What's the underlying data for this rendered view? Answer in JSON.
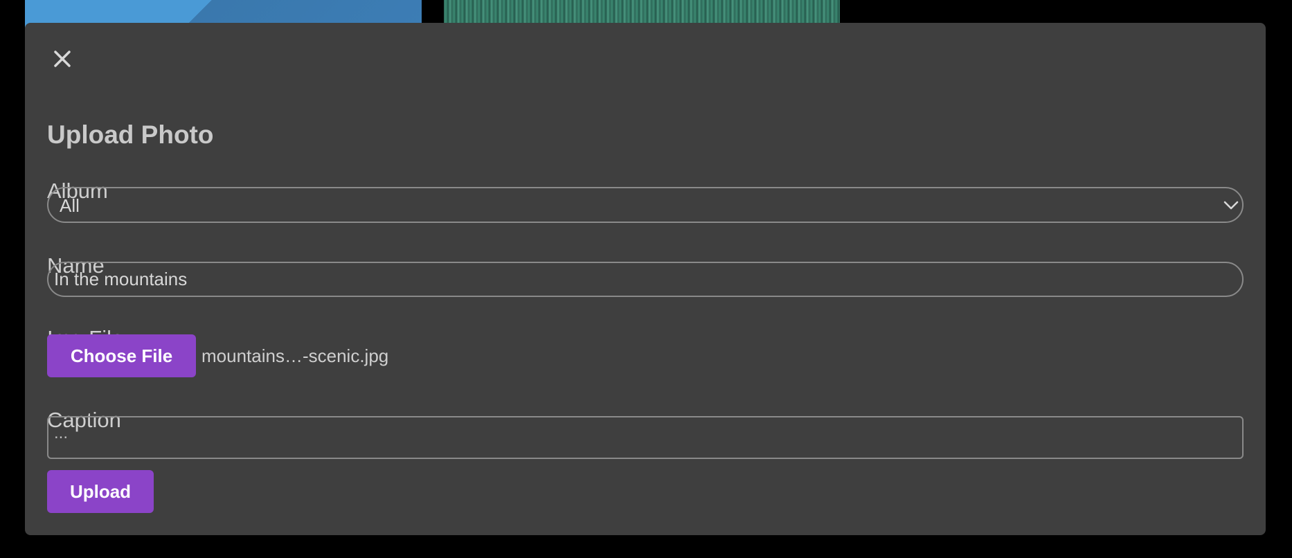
{
  "modal": {
    "title": "Upload Photo",
    "close_icon": "close-icon"
  },
  "form": {
    "album": {
      "label": "Album",
      "selected": "All",
      "chevron_icon": "chevron-down-icon"
    },
    "name": {
      "label": "Name",
      "value": "In the mountains"
    },
    "img_file": {
      "label": "Img File",
      "button_label": "Choose File",
      "file_name": "mountains…-scenic.jpg"
    },
    "caption": {
      "label": "Caption",
      "placeholder": "..."
    },
    "upload_label": "Upload"
  },
  "colors": {
    "accent": "#8b44c8",
    "modal_bg": "#3f3f3f",
    "page_bg": "#000000"
  }
}
